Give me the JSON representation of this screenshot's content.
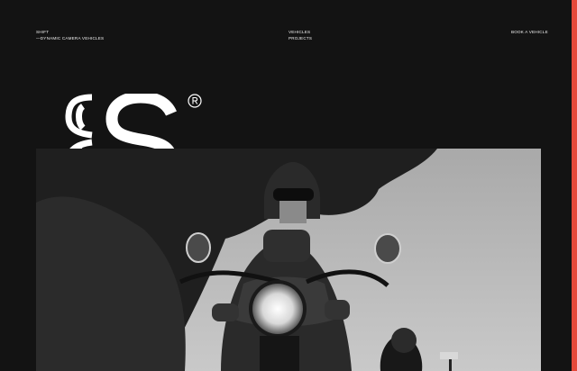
{
  "header": {
    "brand_name": "SHIFT",
    "brand_tagline": "—DYNAMIC CAMERA VEHICLES",
    "nav_items": [
      "VEHICLES",
      "PROJECTS"
    ],
    "cta_label": "BOOK A VEHICLE"
  },
  "logo": {
    "icon": "shift-logo-icon",
    "registered_icon": "registered-mark-icon"
  },
  "hero": {
    "image": "motorcyclist-riding-black-and-white-photo"
  },
  "colors": {
    "background": "#131313",
    "accent": "#e5483a",
    "text": "#ffffff"
  }
}
